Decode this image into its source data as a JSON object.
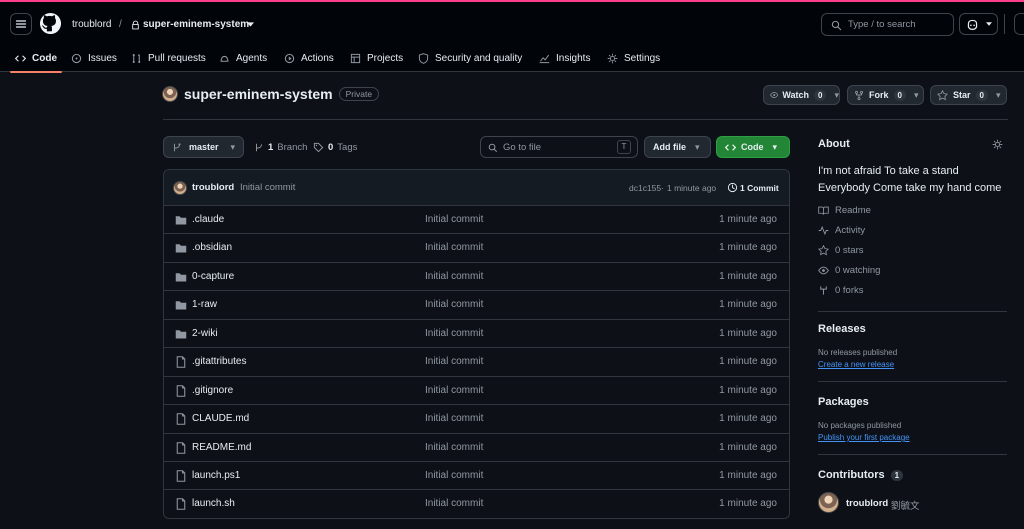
{
  "header": {
    "owner": "troublord",
    "separator": "/",
    "repo": "super-eminem-system",
    "search_placeholder": "Type / to search"
  },
  "tabs": [
    "Code",
    "Issues",
    "Pull requests",
    "Agents",
    "Actions",
    "Projects",
    "Security and quality",
    "Insights",
    "Settings"
  ],
  "repo": {
    "name": "super-eminem-system",
    "visibility": "Private"
  },
  "buttons": {
    "watch": "Watch",
    "watch_count": "0",
    "fork": "Fork",
    "fork_count": "0",
    "star": "Star",
    "star_count": "0",
    "branch": "master",
    "branches": "1",
    "branches_label": "Branch",
    "tags": "0",
    "tags_label": "Tags",
    "go_to_file": "Go to file",
    "shortcut": "T",
    "add_file": "Add file",
    "code": "Code"
  },
  "commit": {
    "author": "troublord",
    "message": "Initial commit",
    "hash": "dc1c155",
    "sep": "·",
    "time": "1 minute ago",
    "commits": "1 Commit"
  },
  "files": [
    {
      "name": ".claude",
      "type": "folder",
      "message": "Initial commit",
      "time": "1 minute ago"
    },
    {
      "name": ".obsidian",
      "type": "folder",
      "message": "Initial commit",
      "time": "1 minute ago"
    },
    {
      "name": "0-capture",
      "type": "folder",
      "message": "Initial commit",
      "time": "1 minute ago"
    },
    {
      "name": "1-raw",
      "type": "folder",
      "message": "Initial commit",
      "time": "1 minute ago"
    },
    {
      "name": "2-wiki",
      "type": "folder",
      "message": "Initial commit",
      "time": "1 minute ago"
    },
    {
      "name": ".gitattributes",
      "type": "file",
      "message": "Initial commit",
      "time": "1 minute ago"
    },
    {
      "name": ".gitignore",
      "type": "file",
      "message": "Initial commit",
      "time": "1 minute ago"
    },
    {
      "name": "CLAUDE.md",
      "type": "file",
      "message": "Initial commit",
      "time": "1 minute ago"
    },
    {
      "name": "README.md",
      "type": "file",
      "message": "Initial commit",
      "time": "1 minute ago"
    },
    {
      "name": "launch.ps1",
      "type": "file",
      "message": "Initial commit",
      "time": "1 minute ago"
    },
    {
      "name": "launch.sh",
      "type": "file",
      "message": "Initial commit",
      "time": "1 minute ago"
    }
  ],
  "about": {
    "title": "About",
    "description_line1": "I'm not afraid To take a stand",
    "description_line2": "Everybody Come take my hand come",
    "readme": "Readme",
    "activity": "Activity",
    "stars": "0 stars",
    "watching": "0 watching",
    "forks": "0 forks"
  },
  "releases": {
    "title": "Releases",
    "text": "No releases published",
    "link": "Create a new release"
  },
  "packages": {
    "title": "Packages",
    "text": "No packages published",
    "link": "Publish your first package"
  },
  "contributors": {
    "title": "Contributors",
    "count": "1",
    "user": "troublord",
    "display_name": "劉毓文"
  }
}
